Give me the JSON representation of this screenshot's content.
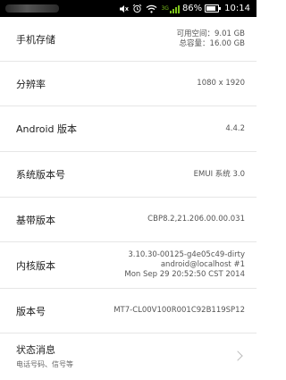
{
  "status_bar": {
    "battery_percent": "86%",
    "battery_level": 0.86,
    "time": "10:14",
    "network": "3G",
    "icons": [
      "mute-icon",
      "alarm-icon",
      "wifi-icon",
      "signal-icon",
      "battery-icon"
    ]
  },
  "rows": [
    {
      "label": "手机存储",
      "values": [
        "可用空间：9.01 GB",
        "总容量：16.00 GB"
      ]
    },
    {
      "label": "分辨率",
      "values": [
        "1080 x 1920"
      ]
    },
    {
      "label": "Android 版本",
      "values": [
        "4.4.2"
      ]
    },
    {
      "label": "系统版本号",
      "values": [
        "EMUI 系统 3.0"
      ]
    },
    {
      "label": "基带版本",
      "values": [
        "CBP8.2,21.206.00.00.031"
      ]
    },
    {
      "label": "内核版本",
      "values": [
        "3.10.30-00125-g4e05c49-dirty",
        "android@localhost #1",
        "Mon Sep 29 20:52:50 CST 2014"
      ]
    },
    {
      "label": "版本号",
      "values": [
        "MT7-CL00V100R001C92B119SP12"
      ]
    }
  ],
  "status_info": {
    "label": "状态消息",
    "subtitle": "电话号码、信号等"
  }
}
